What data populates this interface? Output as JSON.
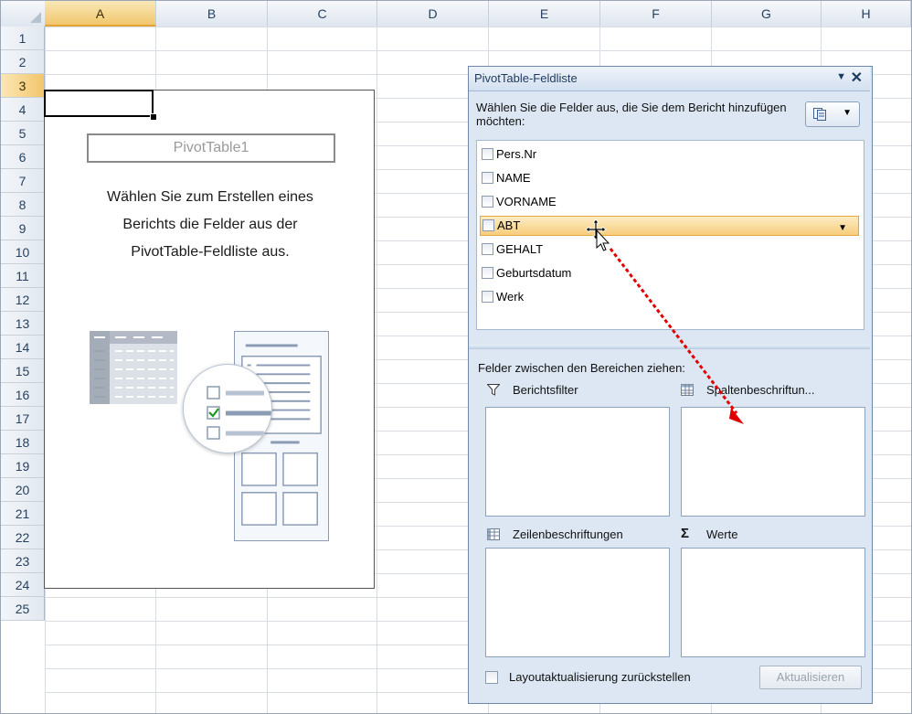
{
  "columns": [
    "A",
    "B",
    "C",
    "D",
    "E",
    "F",
    "G",
    "H"
  ],
  "active_column": "A",
  "rows": [
    "1",
    "2",
    "3",
    "4",
    "5",
    "6",
    "7",
    "8",
    "9",
    "10",
    "11",
    "12",
    "13",
    "14",
    "15",
    "16",
    "17",
    "18",
    "19",
    "20",
    "21",
    "22",
    "23",
    "24",
    "25"
  ],
  "active_row": "3",
  "pivot_placeholder": {
    "name": "PivotTable1",
    "instruction_lines": [
      "Wählen Sie zum Erstellen eines",
      "Berichts die Felder aus der",
      "PivotTable-Feldliste aus."
    ]
  },
  "field_list_panel": {
    "title": "PivotTable-Feldliste",
    "prompt": "Wählen Sie die Felder aus, die Sie dem Bericht hinzufügen möchten:",
    "fields": [
      {
        "label": "Pers.Nr",
        "checked": false
      },
      {
        "label": "NAME",
        "checked": false
      },
      {
        "label": "VORNAME",
        "checked": false
      },
      {
        "label": "ABT",
        "checked": false,
        "highlighted": true
      },
      {
        "label": "GEHALT",
        "checked": false
      },
      {
        "label": "Geburtsdatum",
        "checked": false
      },
      {
        "label": "Werk",
        "checked": false
      }
    ],
    "areas_label": "Felder zwischen den Bereichen ziehen:",
    "areas": {
      "report_filter": "Berichtsfilter",
      "column_labels": "Spaltenbeschriftun...",
      "row_labels": "Zeilenbeschriftungen",
      "values": "Werte"
    },
    "defer_update_label": "Layoutaktualisierung zurückstellen",
    "update_button": "Aktualisieren"
  },
  "colors": {
    "active_header": "#f1c76d",
    "highlight_field": "#f7cd7c",
    "panel_bg": "#dde7f3",
    "drag_arrow": "#e00000"
  },
  "icons": {
    "panel_dropdown": "triangle-down-icon",
    "panel_close": "close-icon",
    "layout": "field-list-layout-icon",
    "report_filter": "funnel-icon",
    "column_labels": "column-grid-icon",
    "row_labels": "row-grid-icon",
    "values": "sigma-icon",
    "cursor": "move-cursor-icon"
  }
}
